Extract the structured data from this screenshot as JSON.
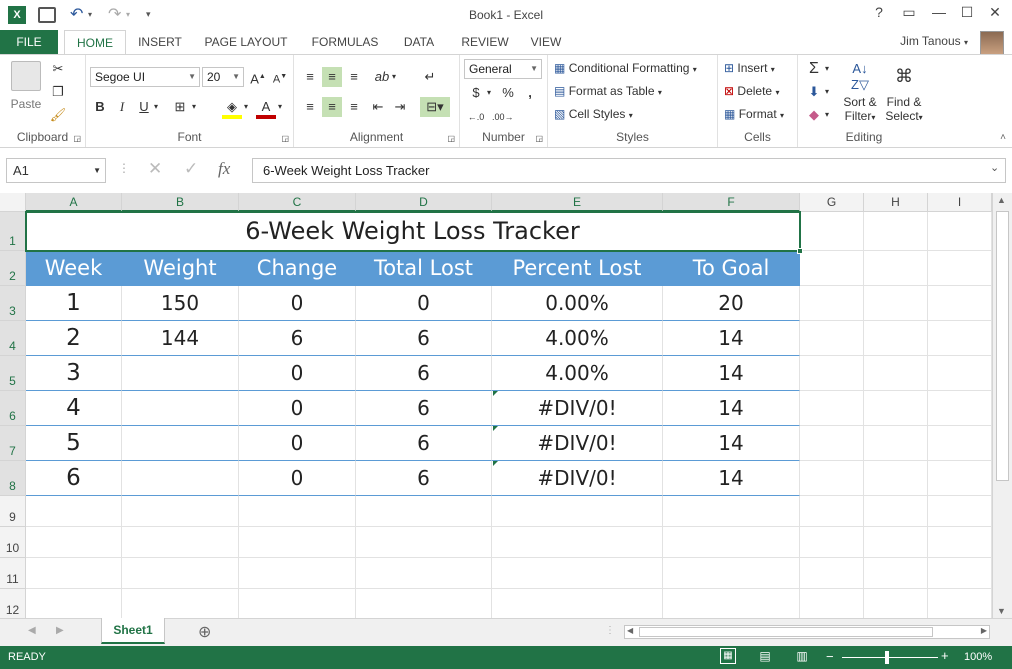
{
  "window": {
    "title": "Book1 - Excel",
    "help": "?",
    "restore_ribbon": "▭",
    "minimize": "—",
    "maximize": "☐",
    "close": "✕"
  },
  "tabs": {
    "file": "FILE",
    "items": [
      "HOME",
      "INSERT",
      "PAGE LAYOUT",
      "FORMULAS",
      "DATA",
      "REVIEW",
      "VIEW"
    ],
    "active": "HOME"
  },
  "user": {
    "name": "Jim Tanous"
  },
  "ribbon": {
    "clipboard": {
      "label": "Clipboard",
      "paste": "Paste"
    },
    "font": {
      "label": "Font",
      "family": "Segoe UI",
      "size": "20",
      "bold": "B",
      "italic": "I",
      "underline": "U"
    },
    "alignment": {
      "label": "Alignment"
    },
    "number": {
      "label": "Number",
      "format": "General",
      "currency": "$",
      "percent": "%",
      "comma": ","
    },
    "styles": {
      "label": "Styles",
      "conditional": "Conditional Formatting",
      "format_table": "Format as Table",
      "cell_styles": "Cell Styles"
    },
    "cells": {
      "label": "Cells",
      "insert": "Insert",
      "delete": "Delete",
      "format": "Format"
    },
    "editing": {
      "label": "Editing",
      "sort_1": "Sort &",
      "sort_2": "Filter",
      "find_1": "Find &",
      "find_2": "Select"
    }
  },
  "formula_bar": {
    "name_box": "A1",
    "fx": "fx",
    "content": "6-Week Weight Loss Tracker"
  },
  "sheet": {
    "columns": [
      "A",
      "B",
      "C",
      "D",
      "E",
      "F",
      "G",
      "H",
      "I"
    ],
    "rows": [
      "1",
      "2",
      "3",
      "4",
      "5",
      "6",
      "7",
      "8",
      "9",
      "10",
      "11",
      "12"
    ],
    "title": "6-Week Weight Loss Tracker",
    "headers": [
      "Week",
      "Weight",
      "Change",
      "Total Lost",
      "Percent Lost",
      "To Goal"
    ],
    "data": [
      [
        "1",
        "150",
        "0",
        "0",
        "0.00%",
        "20"
      ],
      [
        "2",
        "144",
        "6",
        "6",
        "4.00%",
        "14"
      ],
      [
        "3",
        "",
        "0",
        "6",
        "4.00%",
        "14"
      ],
      [
        "4",
        "",
        "0",
        "6",
        "#DIV/0!",
        "14"
      ],
      [
        "5",
        "",
        "0",
        "6",
        "#DIV/0!",
        "14"
      ],
      [
        "6",
        "",
        "0",
        "6",
        "#DIV/0!",
        "14"
      ]
    ]
  },
  "sheet_tabs": {
    "active": "Sheet1",
    "add": "⊕"
  },
  "status": {
    "ready": "READY",
    "zoom": "100%",
    "minus": "−",
    "plus": "+"
  },
  "colors": {
    "accent": "#217346",
    "table_header": "#5b9bd5"
  }
}
